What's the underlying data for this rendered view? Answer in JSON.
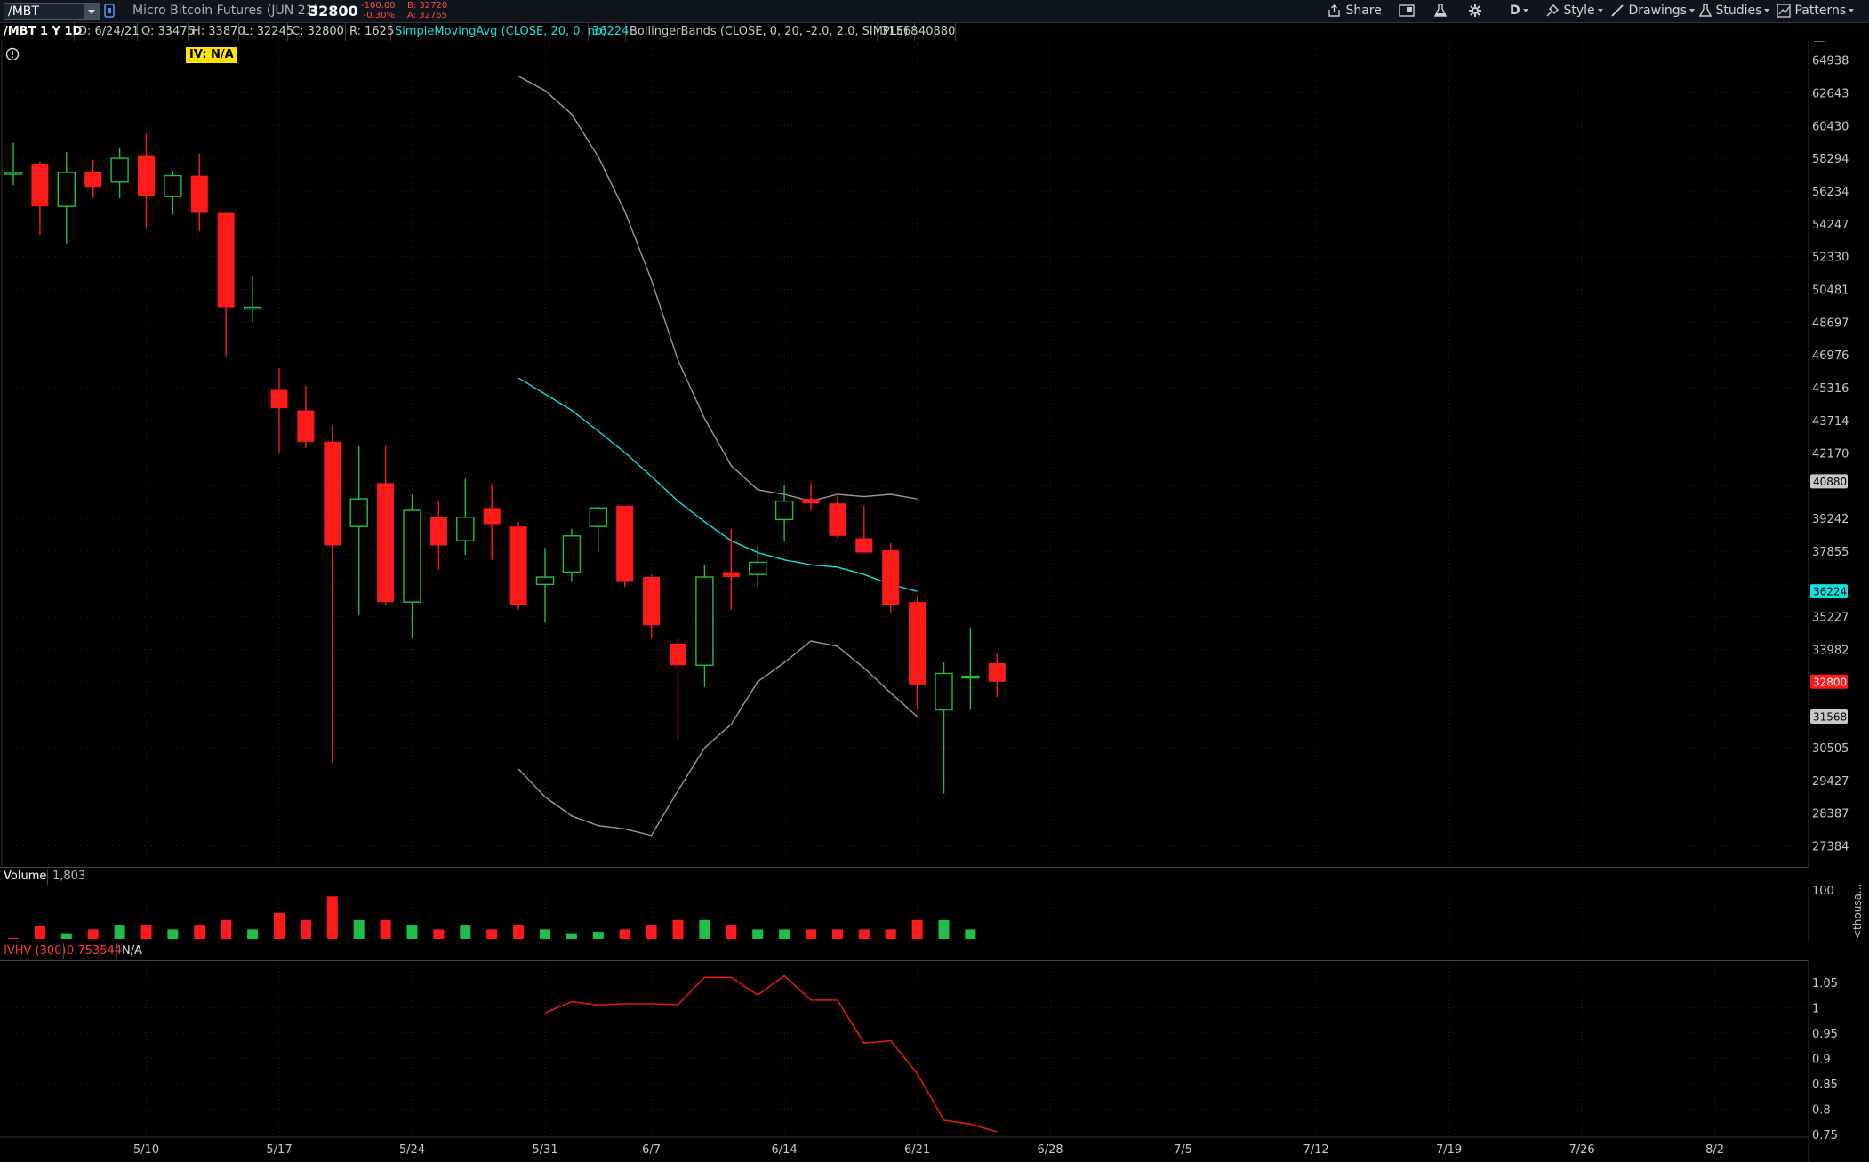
{
  "toolbar": {
    "symbol": "/MBT",
    "description": "Micro Bitcoin Futures (JUN 21)",
    "last_price": "32800",
    "net_change": "-100.00",
    "pct_change": "-0.30%",
    "bid": "B: 32720",
    "ask": "A: 32765",
    "share_label": "Share",
    "aggregation": "D",
    "style_label": "Style",
    "drawings_label": "Drawings",
    "studies_label": "Studies",
    "patterns_label": "Patterns",
    "colors": {
      "bg": "#10141c",
      "up": "#1fbf4a",
      "down": "#ff1a1a"
    }
  },
  "study_row": {
    "chart_label": "/MBT 1 Y 1D",
    "date": "D: 6/24/21",
    "open": "O: 33475",
    "high": "H: 33870",
    "low": "L: 32245",
    "close": "C: 32800",
    "range": "R: 1625",
    "sma_label": "SimpleMovingAvg (CLOSE, 20, 0, no)",
    "sma_value": "36224",
    "bb_label": "BollingerBands (CLOSE, 0, 20, -2.0, 2.0, SIMPLE)",
    "bb_lower": "31568",
    "bb_upper": "40880",
    "iv_badge": "IV: N/A"
  },
  "volume_pane": {
    "label": "Volume",
    "value": "1,803",
    "axis_top": "100",
    "axis_unit": "<thousa..."
  },
  "ivhv_pane": {
    "label": "IVHV (300)",
    "value": "0.753544",
    "na": "N/A"
  },
  "chart_data": [
    {
      "type": "candlestick",
      "title": "/MBT 1 Y 1D",
      "ylim": [
        26867,
        66200
      ],
      "y_ticks": [
        27384,
        28387,
        29427,
        30505,
        31626,
        32800,
        33982,
        35227,
        36517,
        37855,
        39242,
        40681,
        42170,
        43714,
        45316,
        46976,
        48697,
        50481,
        52330,
        54247,
        56234,
        58294,
        60430,
        62643,
        64938
      ],
      "y_tick_labels": [
        "27384",
        "28387",
        "29427",
        "30505",
        "",
        "",
        "33982",
        "35227",
        "",
        "37855",
        "39242",
        "",
        "42170",
        "43714",
        "45316",
        "46976",
        "48697",
        "50481",
        "52330",
        "54247",
        "56234",
        "58294",
        "60430",
        "62643",
        "64938"
      ],
      "x_labels": [
        "5/10",
        "5/17",
        "5/24",
        "5/31",
        "6/7",
        "6/14",
        "6/21",
        "6/28",
        "7/5",
        "7/12",
        "7/19",
        "7/26",
        "8/2"
      ],
      "x_label_positions": [
        5,
        10,
        15,
        20,
        24,
        29,
        34,
        39,
        44,
        49,
        54,
        59,
        64
      ],
      "candles": [
        {
          "o": 57400,
          "h": 59300,
          "l": 56600,
          "c": 57400
        },
        {
          "o": 57900,
          "h": 58100,
          "l": 53600,
          "c": 55300
        },
        {
          "o": 55300,
          "h": 58700,
          "l": 53100,
          "c": 57400
        },
        {
          "o": 57400,
          "h": 58200,
          "l": 55800,
          "c": 56500
        },
        {
          "o": 56800,
          "h": 59000,
          "l": 55800,
          "c": 58300
        },
        {
          "o": 58500,
          "h": 59900,
          "l": 54000,
          "c": 55900
        },
        {
          "o": 55900,
          "h": 57500,
          "l": 54800,
          "c": 57200
        },
        {
          "o": 57200,
          "h": 58600,
          "l": 53800,
          "c": 54900
        },
        {
          "o": 54900,
          "h": 54900,
          "l": 46900,
          "c": 49500
        },
        {
          "o": 49500,
          "h": 51200,
          "l": 48700,
          "c": 49500
        },
        {
          "o": 45200,
          "h": 46300,
          "l": 42200,
          "c": 44300
        },
        {
          "o": 44200,
          "h": 45400,
          "l": 42400,
          "c": 42700
        },
        {
          "o": 42700,
          "h": 43500,
          "l": 30000,
          "c": 38100
        },
        {
          "o": 38900,
          "h": 42500,
          "l": 35300,
          "c": 40100
        },
        {
          "o": 40800,
          "h": 42500,
          "l": 35700,
          "c": 35800
        },
        {
          "o": 35800,
          "h": 40300,
          "l": 34400,
          "c": 39600
        },
        {
          "o": 39300,
          "h": 40000,
          "l": 37100,
          "c": 38100
        },
        {
          "o": 38300,
          "h": 41000,
          "l": 37700,
          "c": 39300
        },
        {
          "o": 39700,
          "h": 40700,
          "l": 37500,
          "c": 39000
        },
        {
          "o": 38900,
          "h": 39100,
          "l": 35500,
          "c": 35700
        },
        {
          "o": 36500,
          "h": 38000,
          "l": 35000,
          "c": 36800
        },
        {
          "o": 37000,
          "h": 38800,
          "l": 36600,
          "c": 38500
        },
        {
          "o": 38900,
          "h": 39800,
          "l": 37800,
          "c": 39700
        },
        {
          "o": 39800,
          "h": 39800,
          "l": 36400,
          "c": 36600
        },
        {
          "o": 36800,
          "h": 36900,
          "l": 34400,
          "c": 34900
        },
        {
          "o": 34200,
          "h": 34400,
          "l": 30800,
          "c": 33400
        },
        {
          "o": 33400,
          "h": 37300,
          "l": 32600,
          "c": 36800
        },
        {
          "o": 37000,
          "h": 38800,
          "l": 35500,
          "c": 36800
        },
        {
          "o": 36900,
          "h": 38100,
          "l": 36400,
          "c": 37400
        },
        {
          "o": 39200,
          "h": 40700,
          "l": 38300,
          "c": 40000
        },
        {
          "o": 40100,
          "h": 40800,
          "l": 39600,
          "c": 39900
        },
        {
          "o": 39900,
          "h": 40400,
          "l": 38400,
          "c": 38500
        },
        {
          "o": 38400,
          "h": 39800,
          "l": 37900,
          "c": 37800
        },
        {
          "o": 37900,
          "h": 38200,
          "l": 35400,
          "c": 35700
        },
        {
          "o": 35800,
          "h": 36000,
          "l": 31800,
          "c": 32700
        },
        {
          "o": 31800,
          "h": 33500,
          "l": 29000,
          "c": 33100
        },
        {
          "o": 33000,
          "h": 34800,
          "l": 31800,
          "c": 33000
        },
        {
          "o": 33475,
          "h": 33870,
          "l": 32245,
          "c": 32800
        }
      ],
      "sma": {
        "name": "SimpleMovingAvg (CLOSE, 20, 0, no)",
        "start": 19,
        "values": [
          45800,
          45000,
          44200,
          43200,
          42200,
          41100,
          40000,
          39100,
          38300,
          37800,
          37500,
          37300,
          37200,
          36900,
          36500,
          36224
        ]
      },
      "bb_upper": {
        "start": 19,
        "values": [
          63800,
          62800,
          61200,
          58400,
          55000,
          51000,
          46700,
          43800,
          41600,
          40500,
          40300,
          40000,
          40300,
          40200,
          40300,
          40100
        ]
      },
      "bb_lower": {
        "start": 19,
        "values": [
          29800,
          28900,
          28300,
          28000,
          27900,
          27700,
          29100,
          30500,
          31300,
          32800,
          33500,
          34300,
          34100,
          33300,
          32400,
          31568
        ]
      },
      "price_tags": [
        {
          "value": 40880,
          "text": "40880",
          "bg": "#c8c8c8",
          "fg": "#000"
        },
        {
          "value": 36224,
          "text": "36224",
          "bg": "#13e0e0",
          "fg": "#000"
        },
        {
          "value": 32800,
          "text": "32800",
          "bg": "#ff1a1a",
          "fg": "#fff"
        },
        {
          "value": 31568,
          "text": "31568",
          "bg": "#c8c8c8",
          "fg": "#000"
        }
      ]
    },
    {
      "type": "bar",
      "title": "Volume",
      "volume": [
        2,
        28,
        12,
        20,
        30,
        30,
        20,
        30,
        40,
        20,
        55,
        40,
        90,
        40,
        40,
        30,
        20,
        30,
        20,
        30,
        20,
        12,
        15,
        20,
        30,
        40,
        40,
        30,
        20,
        20,
        20,
        20,
        20,
        20,
        40,
        40,
        20
      ],
      "direction": [
        "down",
        "down",
        "up",
        "down",
        "up",
        "down",
        "up",
        "down",
        "down",
        "up",
        "down",
        "down",
        "down",
        "up",
        "down",
        "up",
        "down",
        "up",
        "down",
        "down",
        "up",
        "up",
        "up",
        "down",
        "down",
        "down",
        "up",
        "down",
        "up",
        "up",
        "down",
        "down",
        "down",
        "down",
        "down",
        "up",
        "up"
      ],
      "ylim": [
        0,
        100
      ]
    },
    {
      "type": "line",
      "title": "IVHV (300)",
      "start": 20,
      "values": [
        0.99,
        1.012,
        1.005,
        1.008,
        1.008,
        1.006,
        1.06,
        1.06,
        1.025,
        1.063,
        1.015,
        1.015,
        0.93,
        0.935,
        0.87,
        0.778,
        0.77,
        0.755
      ],
      "ylim": [
        0.748,
        1.085
      ],
      "y_ticks": [
        1.05,
        1,
        0.95,
        0.9,
        0.85,
        0.8,
        0.75
      ],
      "y_tick_labels": [
        "1.05",
        "1",
        "0.95",
        "0.9",
        "0.85",
        "0.8",
        "0.75"
      ]
    }
  ]
}
